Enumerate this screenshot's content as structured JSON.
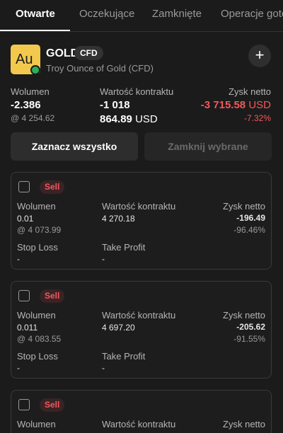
{
  "tabs": [
    "Otwarte",
    "Oczekujące",
    "Zamknięte",
    "Operacje gotó"
  ],
  "instrument": {
    "logo": "Au",
    "name": "GOLD",
    "badge": "CFD",
    "description": "Troy Ounce of Gold (CFD)",
    "add_icon": "+"
  },
  "summary": {
    "volume_label": "Wolumen",
    "volume_value": "-2.386",
    "volume_price": "@ 4 254.62",
    "contract_label": "Wartość kontraktu",
    "contract_value_line1": "-1 018",
    "contract_value_line2": "864.89",
    "contract_currency": "USD",
    "profit_label": "Zysk netto",
    "profit_value": "-3 715.58",
    "profit_currency": "USD",
    "profit_percent": "-7.32%"
  },
  "buttons": {
    "select_all": "Zaznacz wszystko",
    "close_selected": "Zamknij wybrane"
  },
  "labels": {
    "sell": "Sell",
    "volume": "Wolumen",
    "contract": "Wartość kontraktu",
    "profit": "Zysk netto",
    "stop_loss": "Stop Loss",
    "take_profit": "Take Profit"
  },
  "positions": [
    {
      "volume": "0.01",
      "price": "@ 4 073.99",
      "contract": "4 270.18",
      "profit": "-196.49",
      "percent": "-96.46%",
      "stop_loss": "-",
      "take_profit": "-"
    },
    {
      "volume": "0.011",
      "price": "@ 4 083.55",
      "contract": "4 697.20",
      "profit": "-205.62",
      "percent": "-91.55%",
      "stop_loss": "-",
      "take_profit": "-"
    }
  ],
  "colors": {
    "accent_gold": "#f2c94c",
    "negative": "#f0595c",
    "online_dot": "#2bb15c"
  }
}
